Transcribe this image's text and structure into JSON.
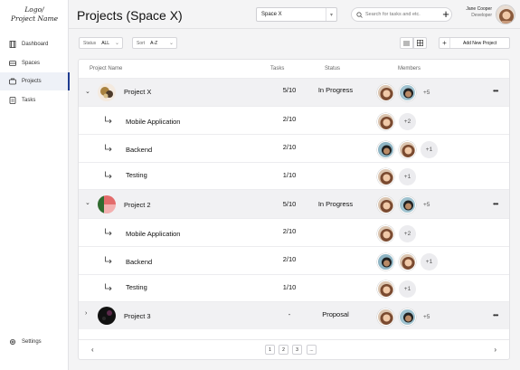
{
  "logo": {
    "line1": "Logo/",
    "line2": "Project Name"
  },
  "sidebar": {
    "items": [
      {
        "label": "Dashboard",
        "icon": "dashboard-icon"
      },
      {
        "label": "Spaces",
        "icon": "spaces-icon"
      },
      {
        "label": "Projects",
        "icon": "projects-icon",
        "active": true
      },
      {
        "label": "Tasks",
        "icon": "tasks-icon"
      }
    ],
    "settings": "Settings"
  },
  "header": {
    "title": "Projects (Space X)",
    "space_select": "Space X",
    "search_placeholder": "Search for tasks and etc.",
    "user_name": "Jane Cooper",
    "user_role": "Developer"
  },
  "toolbar": {
    "status_label": "Status",
    "status_value": "ALL",
    "sort_label": "Sort",
    "sort_value": "A-Z",
    "add_label": "Add New Project"
  },
  "table": {
    "columns": {
      "name": "Project Name",
      "tasks": "Tasks",
      "status": "Status",
      "members": "Members"
    },
    "rows": [
      {
        "type": "parent",
        "name": "Project X",
        "tasks": "5/10",
        "status": "In Progress",
        "more": "+5"
      },
      {
        "type": "child",
        "name": "Mobile Application",
        "tasks": "2/10",
        "status": "",
        "more": "+2"
      },
      {
        "type": "child",
        "name": "Backend",
        "tasks": "2/10",
        "status": "",
        "more": "+1"
      },
      {
        "type": "child",
        "name": "Testing",
        "tasks": "1/10",
        "status": "",
        "more": "+1"
      },
      {
        "type": "parent",
        "name": "Project 2",
        "tasks": "5/10",
        "status": "In Progress",
        "more": "+5"
      },
      {
        "type": "child",
        "name": "Mobile Application",
        "tasks": "2/10",
        "status": "",
        "more": "+2"
      },
      {
        "type": "child",
        "name": "Backend",
        "tasks": "2/10",
        "status": "",
        "more": "+1"
      },
      {
        "type": "child",
        "name": "Testing",
        "tasks": "1/10",
        "status": "",
        "more": "+1"
      },
      {
        "type": "parent",
        "name": "Project 3",
        "tasks": "-",
        "status": "Proposal",
        "more": "+5"
      }
    ],
    "pagination": {
      "pages": [
        "1",
        "2",
        "3",
        "..."
      ]
    }
  }
}
